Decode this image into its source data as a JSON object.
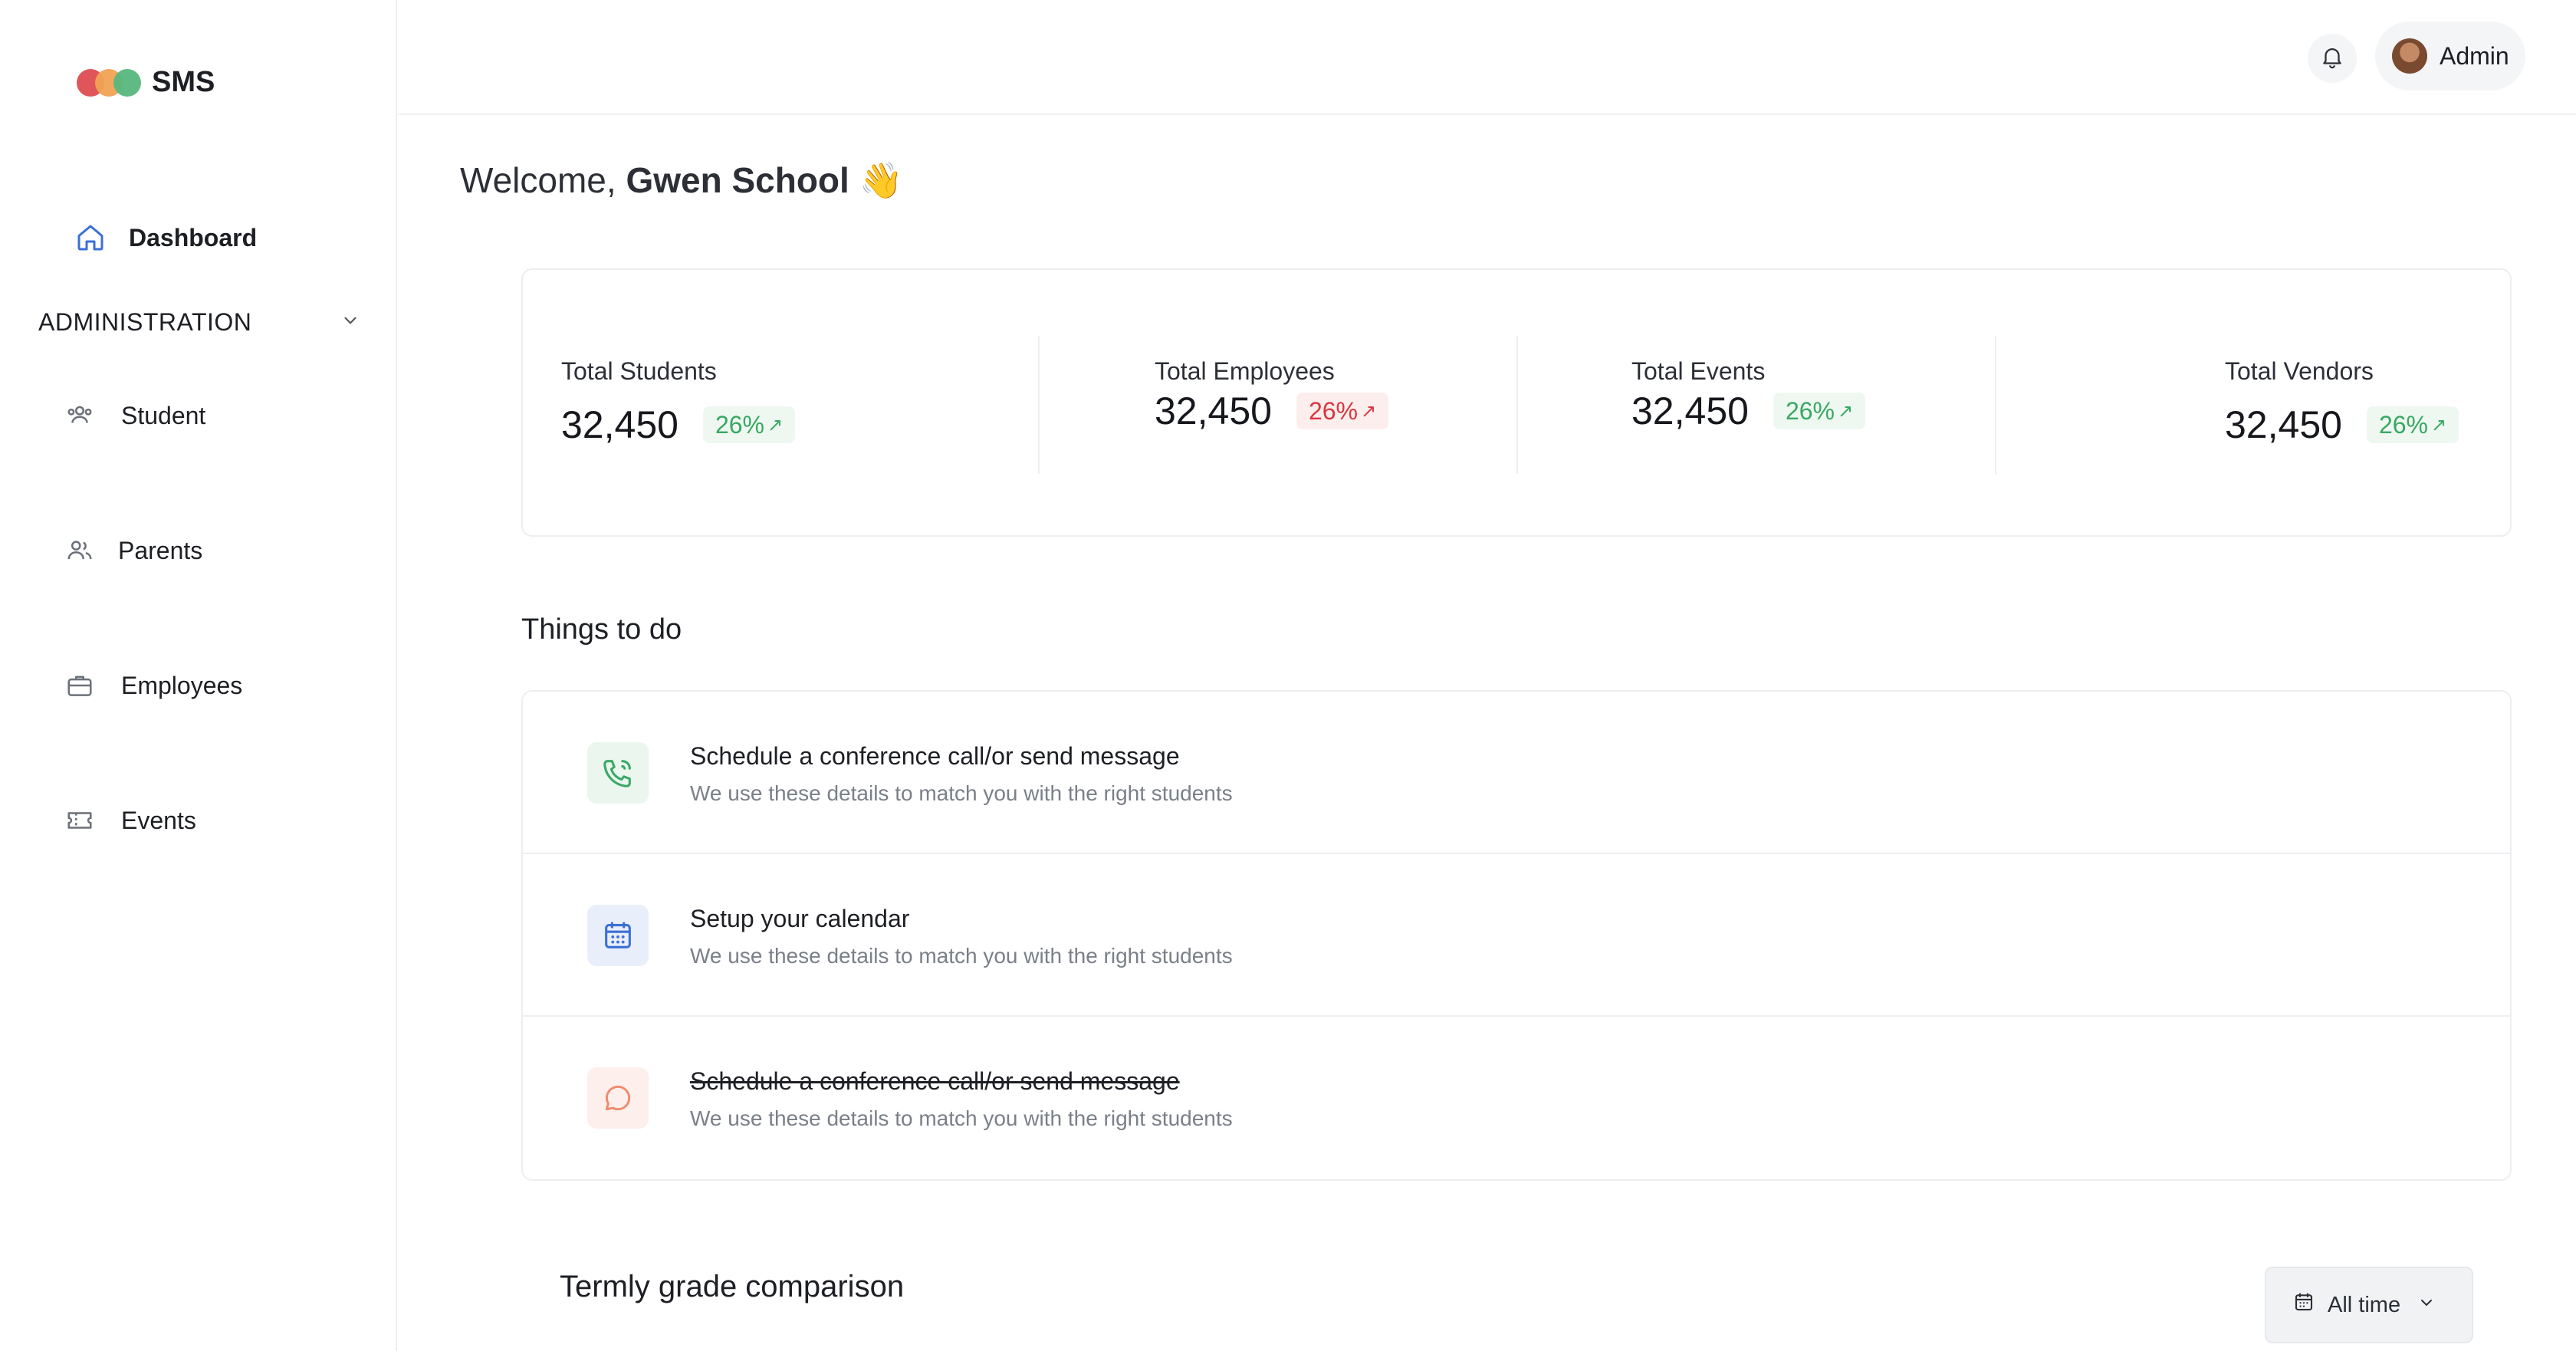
{
  "app": {
    "name": "SMS"
  },
  "sidebar": {
    "dashboard_label": "Dashboard",
    "section_label": "ADMINISTRATION",
    "items": [
      {
        "label": "Student",
        "icon": "users-icon"
      },
      {
        "label": "Parents",
        "icon": "parents-icon"
      },
      {
        "label": "Employees",
        "icon": "briefcase-icon"
      },
      {
        "label": "Events",
        "icon": "ticket-icon"
      }
    ]
  },
  "header": {
    "user_name": "Admin"
  },
  "welcome": {
    "prefix": "Welcome,",
    "name": "Gwen School",
    "emoji": "👋"
  },
  "stats": [
    {
      "label": "Total Students",
      "value": "32,450",
      "change": "26%",
      "trend": "up"
    },
    {
      "label": "Total Employees",
      "value": "32,450",
      "change": "26%",
      "trend": "down"
    },
    {
      "label": "Total Events",
      "value": "32,450",
      "change": "26%",
      "trend": "up"
    },
    {
      "label": "Total Vendors",
      "value": "32,450",
      "change": "26%",
      "trend": "up"
    }
  ],
  "todo": {
    "title": "Things to do",
    "items": [
      {
        "title": "Schedule a conference call/or send message",
        "desc": "We use these details to match you with the right students",
        "icon": "phone-icon",
        "done": false
      },
      {
        "title": "Setup your calendar",
        "desc": "We use these details to match you with the right students",
        "icon": "calendar-icon",
        "done": false
      },
      {
        "title": "Schedule a conference call/or send message",
        "desc": "We use these details to match you with the right students",
        "icon": "chat-icon",
        "done": true
      }
    ]
  },
  "grades": {
    "title": "Termly grade comparison",
    "filter_label": "All time"
  },
  "colors": {
    "accent_blue": "#3b6fd8",
    "up_green": "#38a862",
    "down_red": "#d9363e"
  }
}
